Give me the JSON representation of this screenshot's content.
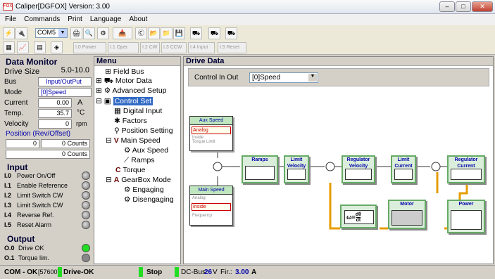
{
  "window": {
    "title": "Caliper[DGFOX] Version: 3.00",
    "icon_text": "FOX"
  },
  "menu": [
    "File",
    "Commands",
    "Print",
    "Language",
    "About"
  ],
  "toolbar": {
    "port": "COM5",
    "buttons2": [
      "I.0 Power",
      "I.1 Oper.",
      "I.2 CW",
      "I.3 CCW",
      "I.4 Input",
      "I.5 Reset"
    ]
  },
  "monitor": {
    "title": "Data Monitor",
    "drive_size": {
      "label": "Drive Size",
      "value": "5.0-10.0"
    },
    "bus": {
      "label": "Bus",
      "value": "Input/OutPut"
    },
    "mode": {
      "label": "Mode",
      "value": "[0]Speed"
    },
    "current": {
      "label": "Current",
      "value": "0.00",
      "unit": "A"
    },
    "temp": {
      "label": "Temp.",
      "value": "35.7",
      "unit": "°C"
    },
    "velocity": {
      "label": "Velocity",
      "value": "0",
      "unit": "rpm"
    },
    "position": {
      "label": "Position (Rev/Offset)",
      "rev": "0",
      "offset": "0 Counts",
      "total": "0 Counts"
    }
  },
  "inputs": {
    "title": "Input",
    "items": [
      {
        "code": "I.0",
        "name": "Power On/Off"
      },
      {
        "code": "I.1",
        "name": "Enable Reference"
      },
      {
        "code": "I.2",
        "name": "Limit Switch CW"
      },
      {
        "code": "I.3",
        "name": "Limit Switch CW"
      },
      {
        "code": "I.4",
        "name": "Reverse Ref."
      },
      {
        "code": "I.5",
        "name": "Reset Alarm"
      }
    ]
  },
  "outputs": {
    "title": "Output",
    "items": [
      {
        "code": "O.0",
        "name": "Drive OK",
        "color": "#22dd22"
      },
      {
        "code": "O.1",
        "name": "Torque lim.",
        "color": "#888888"
      }
    ]
  },
  "menu_panel": {
    "title": "Menu"
  },
  "tree": [
    "Field Bus",
    "Motor Data",
    "Advanced Setup",
    "Control Set",
    "Digital Input",
    "Factors",
    "Position Setting",
    "Main Speed",
    "Aux Speed",
    "Ramps",
    "Torque",
    "GearBox Mode",
    "Engaging",
    "Disengaging"
  ],
  "drive": {
    "title": "Drive Data",
    "control_label": "Control In Out",
    "control_value": "[0]Speed",
    "aux_speed": {
      "title": "Aux Speed",
      "items": [
        "Analog",
        "Inside",
        "Torque Limit"
      ],
      "selected": "Analog"
    },
    "main_speed": {
      "title": "Main Speed",
      "items": [
        "Analog",
        "Inside",
        "Frequency"
      ],
      "selected": "Inside"
    },
    "ramps": "Ramps",
    "limit_velocity": "Limit Velocity",
    "regulator_velocity": "Regulator Velocity",
    "limit_current": "Limit Current",
    "regulator_current": "Regulator Current",
    "power": "Power",
    "motor": "Motor",
    "omega": "ω=",
    "dtheta": "dθ",
    "dt": "dt"
  },
  "status": {
    "com": "COM - OK",
    "baud": "[57600]",
    "drive": "Drive-OK",
    "stop": "Stop",
    "dcbus": "DC-Bus",
    "dcbus_val": "26",
    "dcbus_unit": "V",
    "fir": "Fir.:",
    "fir_val": "3.00",
    "fir_unit": "A"
  }
}
